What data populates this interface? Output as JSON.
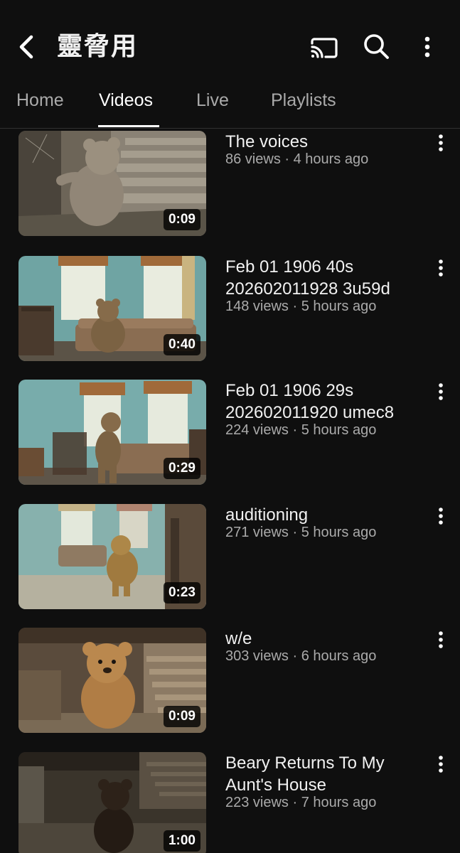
{
  "header": {
    "channel_title": "靈脅用",
    "icons": [
      "back-arrow-icon",
      "cast-icon",
      "search-icon",
      "more-vert-icon"
    ]
  },
  "tabs": [
    {
      "label": "Home",
      "active": false
    },
    {
      "label": "Videos",
      "active": true
    },
    {
      "label": "Live",
      "active": false
    },
    {
      "label": "Playlists",
      "active": false
    }
  ],
  "videos": [
    {
      "title": "The voices",
      "meta": "86 views · 4 hours ago",
      "duration": "0:09"
    },
    {
      "title": "Feb 01  1906 40s 202602011928 3u59d",
      "meta": "148 views · 5 hours ago",
      "duration": "0:40"
    },
    {
      "title": "Feb 01  1906 29s 202602011920 umec8",
      "meta": "224 views · 5 hours ago",
      "duration": "0:29"
    },
    {
      "title": "auditioning",
      "meta": "271 views · 5 hours ago",
      "duration": "0:23"
    },
    {
      "title": "w/e",
      "meta": "303 views · 6 hours ago",
      "duration": "0:09"
    },
    {
      "title": "Beary Returns To My Aunt's House",
      "meta": "223 views · 7 hours ago",
      "duration": "1:00"
    }
  ],
  "colors": {
    "background": "#0f0f0f",
    "text_primary": "#f1f1f1",
    "text_secondary": "#aaaaaa",
    "divider": "#303030"
  }
}
